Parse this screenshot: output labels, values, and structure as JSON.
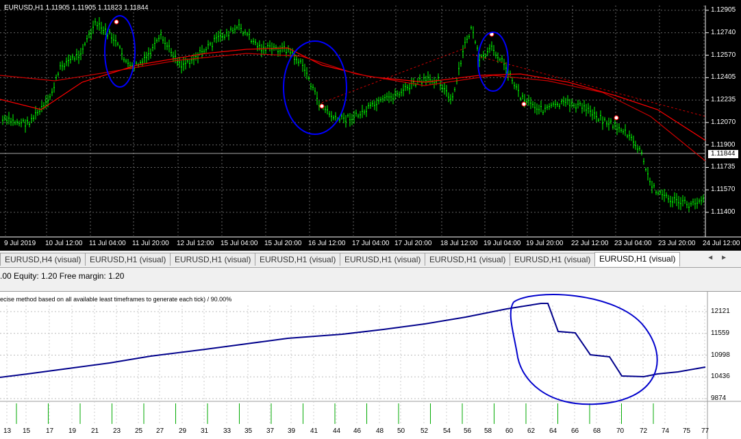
{
  "chart": {
    "header": "EURUSD,H1  1.11905 1.11905 1.11823 1.11844",
    "current_price": "1.11844",
    "y_labels": [
      "1.12905",
      "1.12740",
      "1.12570",
      "1.12405",
      "1.12235",
      "1.12070",
      "1.11900",
      "1.11735",
      "1.11570",
      "1.11400"
    ],
    "x_labels": [
      "9 Jul 2019",
      "10 Jul 12:00",
      "11 Jul 04:00",
      "11 Jul 20:00",
      "12 Jul 12:00",
      "15 Jul 04:00",
      "15 Jul 20:00",
      "16 Jul 12:00",
      "17 Jul 04:00",
      "17 Jul 20:00",
      "18 Jul 12:00",
      "19 Jul 04:00",
      "19 Jul 20:00",
      "22 Jul 12:00",
      "23 Jul 04:00",
      "23 Jul 20:00",
      "24 Jul 12:00"
    ],
    "colors": {
      "background": "#000000",
      "bars": "#00ff00",
      "ma": "#ff0000",
      "annotation": "#0000ff"
    }
  },
  "tabs": [
    "EURUSD,H4 (visual)",
    "EURUSD,H1 (visual)",
    "EURUSD,H1 (visual)",
    "EURUSD,H1 (visual)",
    "EURUSD,H1 (visual)",
    "EURUSD,H1 (visual)",
    "EURUSD,H1 (visual)",
    "EURUSD,H1 (visual)"
  ],
  "tab_nav": {
    "left": "◄",
    "right": "►"
  },
  "status": ".00  Equity: 1.20  Free margin: 1.20",
  "equity": {
    "caption": "ecise method based on all available least timeframes to generate each tick) / 90.00%",
    "y_labels": [
      "12121",
      "11559",
      "10998",
      "10436",
      "9874"
    ],
    "x_labels": [
      "13",
      "15",
      "17",
      "19",
      "21",
      "23",
      "25",
      "27",
      "29",
      "31",
      "33",
      "35",
      "37",
      "39",
      "41",
      "44",
      "46",
      "48",
      "50",
      "52",
      "54",
      "56",
      "58",
      "60",
      "62",
      "64",
      "66",
      "68",
      "70",
      "72",
      "74",
      "75",
      "77"
    ],
    "colors": {
      "line": "#00008b",
      "bars": "#00aa00",
      "annotation": "#0000cc"
    }
  }
}
